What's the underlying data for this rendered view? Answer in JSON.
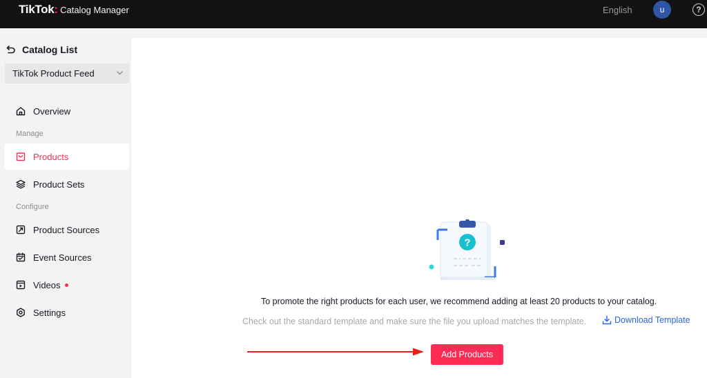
{
  "header": {
    "logo": "TikTok",
    "logo_colon": ":",
    "product_name": "Catalog Manager",
    "language": "English",
    "avatar_initial": "u",
    "help_icon": "question-circle-icon"
  },
  "sidebar": {
    "back_label": "Catalog List",
    "catalog_select": "TikTok Product Feed",
    "sections": {
      "manage": "Manage",
      "configure": "Configure"
    },
    "items": [
      {
        "label": "Overview",
        "icon": "home-icon",
        "active": false
      },
      {
        "label": "Products",
        "icon": "bag-icon",
        "active": true
      },
      {
        "label": "Product Sets",
        "icon": "layers-icon",
        "active": false
      },
      {
        "label": "Product Sources",
        "icon": "source-icon",
        "active": false
      },
      {
        "label": "Event Sources",
        "icon": "calendar-icon",
        "active": false
      },
      {
        "label": "Videos",
        "icon": "video-icon",
        "active": false,
        "badge_dot": true
      },
      {
        "label": "Settings",
        "icon": "settings-icon",
        "active": false
      }
    ]
  },
  "main": {
    "empty_message": "To promote the right products for each user, we recommend adding at least 20 products to your catalog.",
    "template_hint": "Check out the standard template and make sure the file you upload matches the template.",
    "download_template_label": "Download Template",
    "add_products_label": "Add Products"
  },
  "colors": {
    "accent": "#fe2c55",
    "link": "#2a64e8",
    "topbar": "#121212",
    "sidebar_bg": "#f3f3f3"
  }
}
